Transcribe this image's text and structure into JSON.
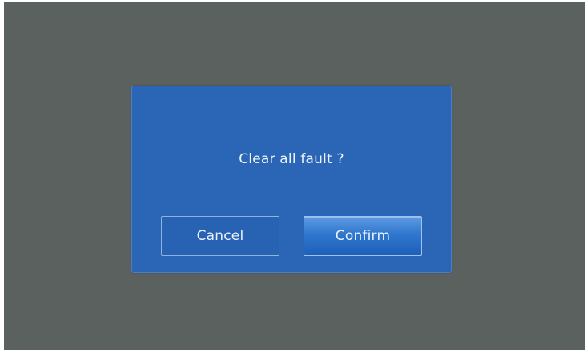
{
  "dialog": {
    "message": "Clear all fault ?",
    "cancel_label": "Cancel",
    "confirm_label": "Confirm"
  },
  "colors": {
    "backdrop": "#5b615f",
    "dialog_background": "#2a65b6",
    "confirm_button": "#2f77cf",
    "text": "#eef3fb"
  }
}
